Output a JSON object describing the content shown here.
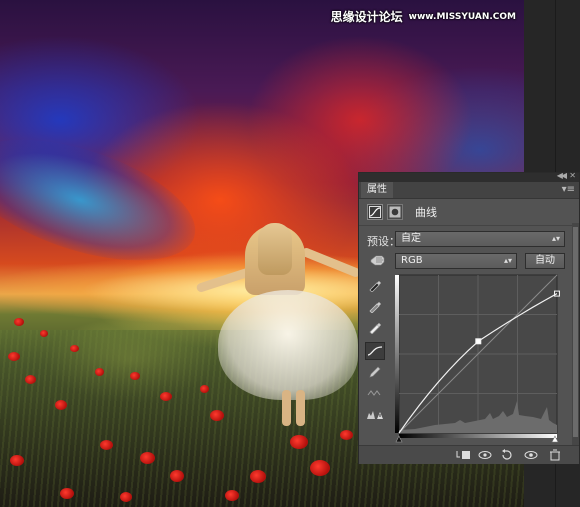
{
  "watermark": {
    "text": "思缘设计论坛",
    "url": "www.MISSYUAN.COM"
  },
  "panel": {
    "tab_label": "属性",
    "adjustment_title": "曲线",
    "preset_label": "预设：",
    "preset_value": "自定",
    "channel_value": "RGB",
    "auto_label": "自动",
    "curve_points": [
      {
        "input": 0,
        "output": 0
      },
      {
        "input": 128,
        "output": 148
      },
      {
        "input": 255,
        "output": 225
      }
    ]
  },
  "icons": {
    "collapse": "double-chevron-left-icon",
    "close": "close-icon",
    "menu": "panel-menu-icon",
    "adjustment_type": "curves-adjustment-icon",
    "mask": "layer-mask-icon",
    "target_adjust": "hand-target-icon",
    "tools": [
      "eyedropper-black-icon",
      "eyedropper-gray-icon",
      "eyedropper-white-icon",
      "curve-point-icon",
      "pencil-icon",
      "smooth-icon",
      "clipping-warning-icon"
    ],
    "bottom": [
      "clip-to-layer-icon",
      "view-previous-icon",
      "reset-icon",
      "visibility-icon",
      "delete-icon"
    ]
  }
}
